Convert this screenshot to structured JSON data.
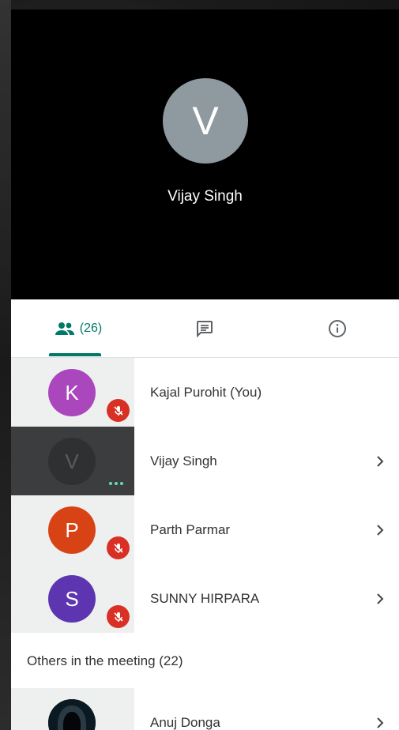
{
  "speaker": {
    "initial": "V",
    "name": "Vijay Singh",
    "avatar_color": "#8e9aa0"
  },
  "tabs": {
    "people_count": "(26)"
  },
  "participants": [
    {
      "initial": "K",
      "name": "Kajal Purohit (You)",
      "avatar_color": "#ab47bc",
      "muted": true,
      "has_chevron": false
    },
    {
      "initial": "V",
      "name": "Vijay Singh",
      "avatar_color": "#3c3d3f",
      "muted": false,
      "speaking": true,
      "has_chevron": true
    },
    {
      "initial": "P",
      "name": "Parth Parmar",
      "avatar_color": "#d84315",
      "muted": true,
      "has_chevron": true
    },
    {
      "initial": "S",
      "name": "SUNNY HIRPARA",
      "avatar_color": "#5e35b1",
      "muted": true,
      "has_chevron": true
    }
  ],
  "others_section": {
    "label": "Others in the meeting (22)"
  },
  "others": [
    {
      "name": "Anuj Donga",
      "avatar": "hooded-figure-photo",
      "muted": true,
      "has_chevron": true
    }
  ],
  "colors": {
    "accent": "#00796b",
    "mute_red": "#d93025",
    "speaking_dots": "#5ee0b5"
  }
}
